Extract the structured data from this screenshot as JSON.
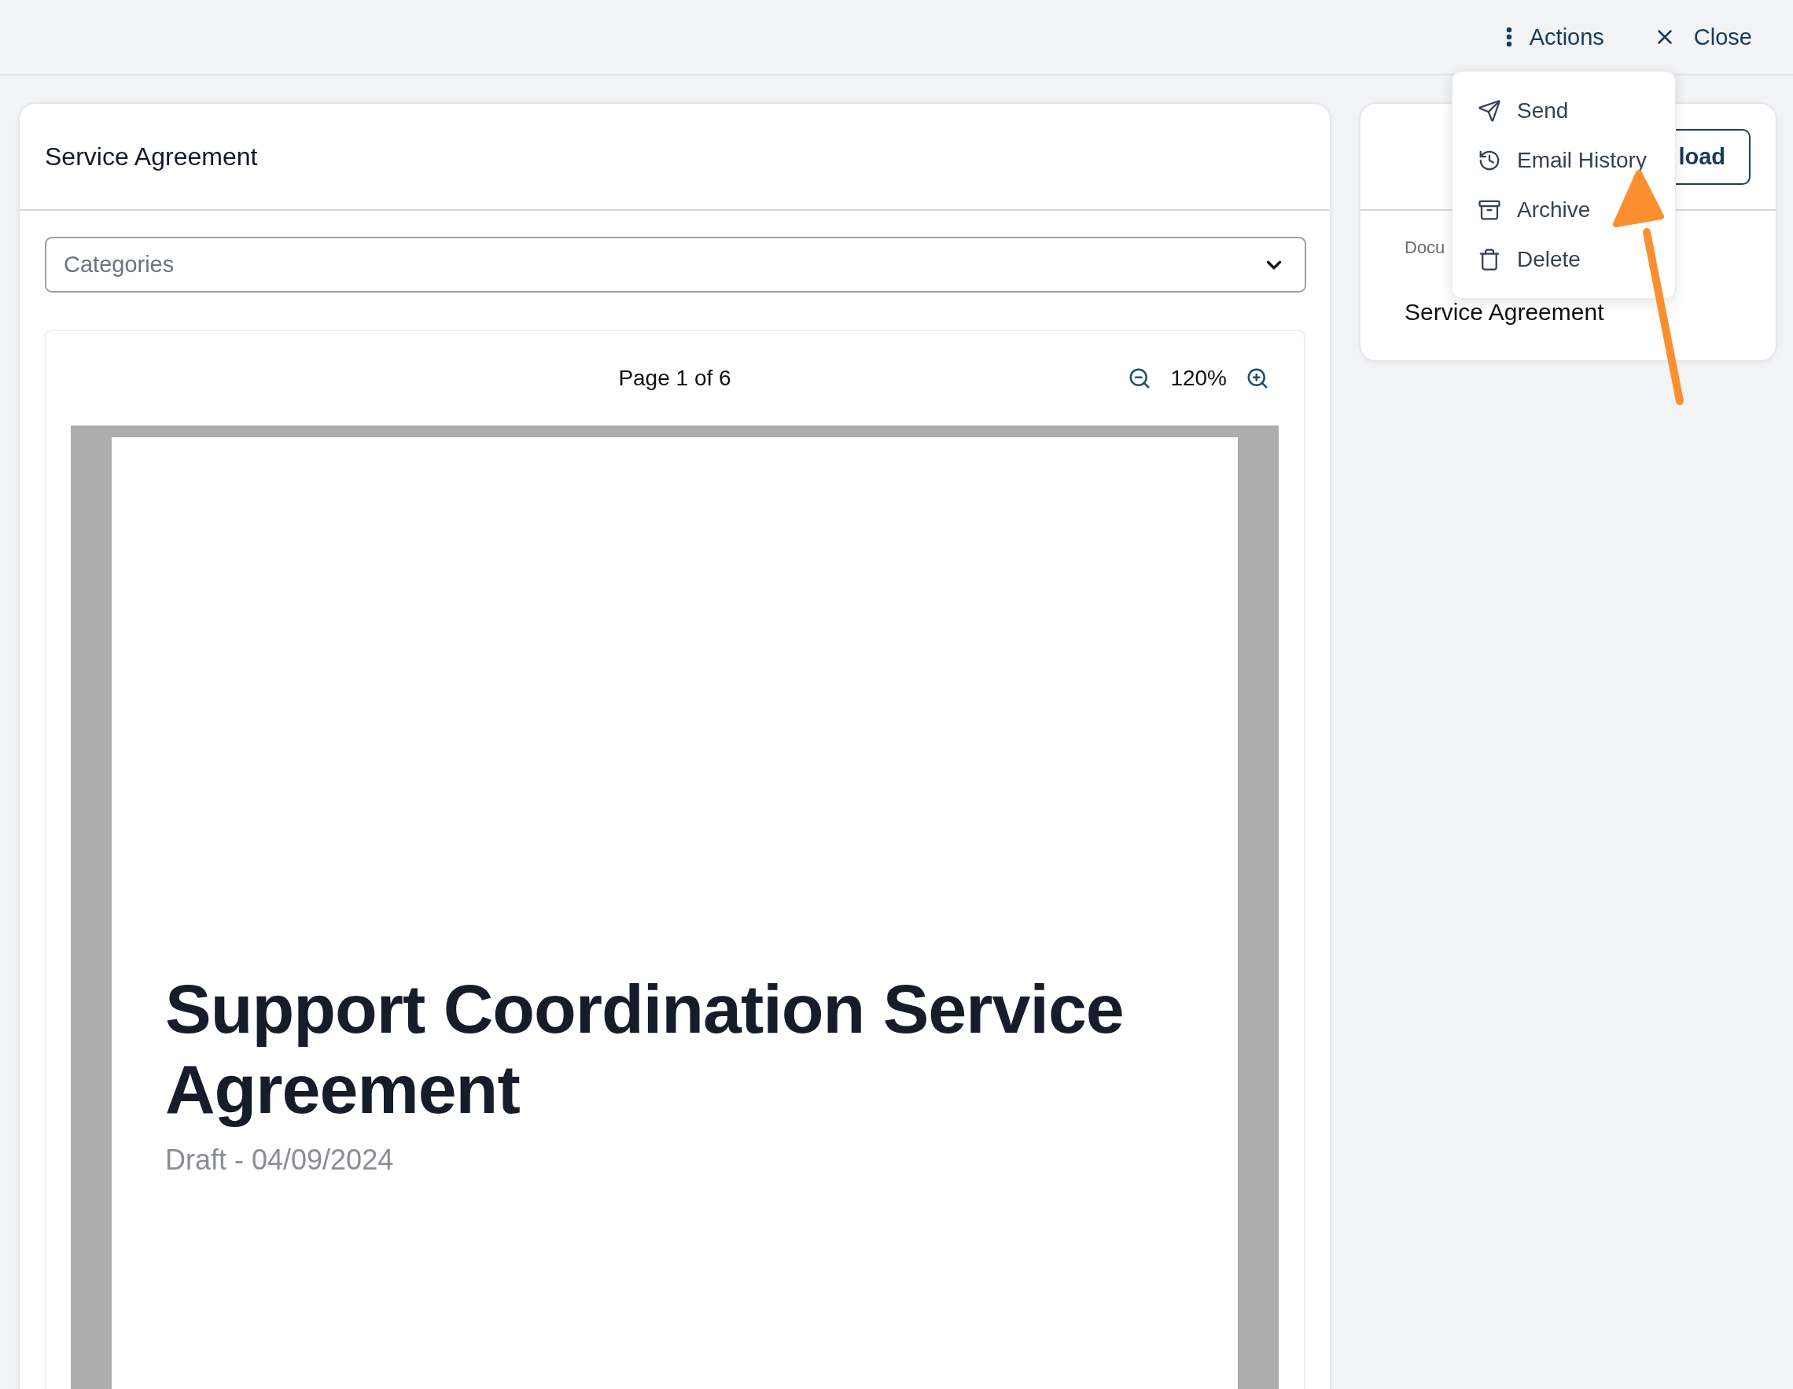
{
  "top_bar": {
    "actions_label": "Actions",
    "close_label": "Close"
  },
  "document_card": {
    "title": "Service Agreement",
    "category_select": {
      "placeholder": "Categories"
    },
    "viewer": {
      "page_indicator": "Page 1 of 6",
      "zoom": "120%",
      "page": {
        "heading": "Support Coordination Service Agreement",
        "subtitle": "Draft - 04/09/2024"
      }
    }
  },
  "details_card": {
    "button_label": "load",
    "field_label": "Docu",
    "field_value": "Service Agreement"
  },
  "actions_menu": {
    "items": [
      {
        "label": "Send",
        "kind": "send"
      },
      {
        "label": "Email History",
        "kind": "history"
      },
      {
        "label": "Archive",
        "kind": "archive"
      },
      {
        "label": "Delete",
        "kind": "delete"
      }
    ]
  }
}
